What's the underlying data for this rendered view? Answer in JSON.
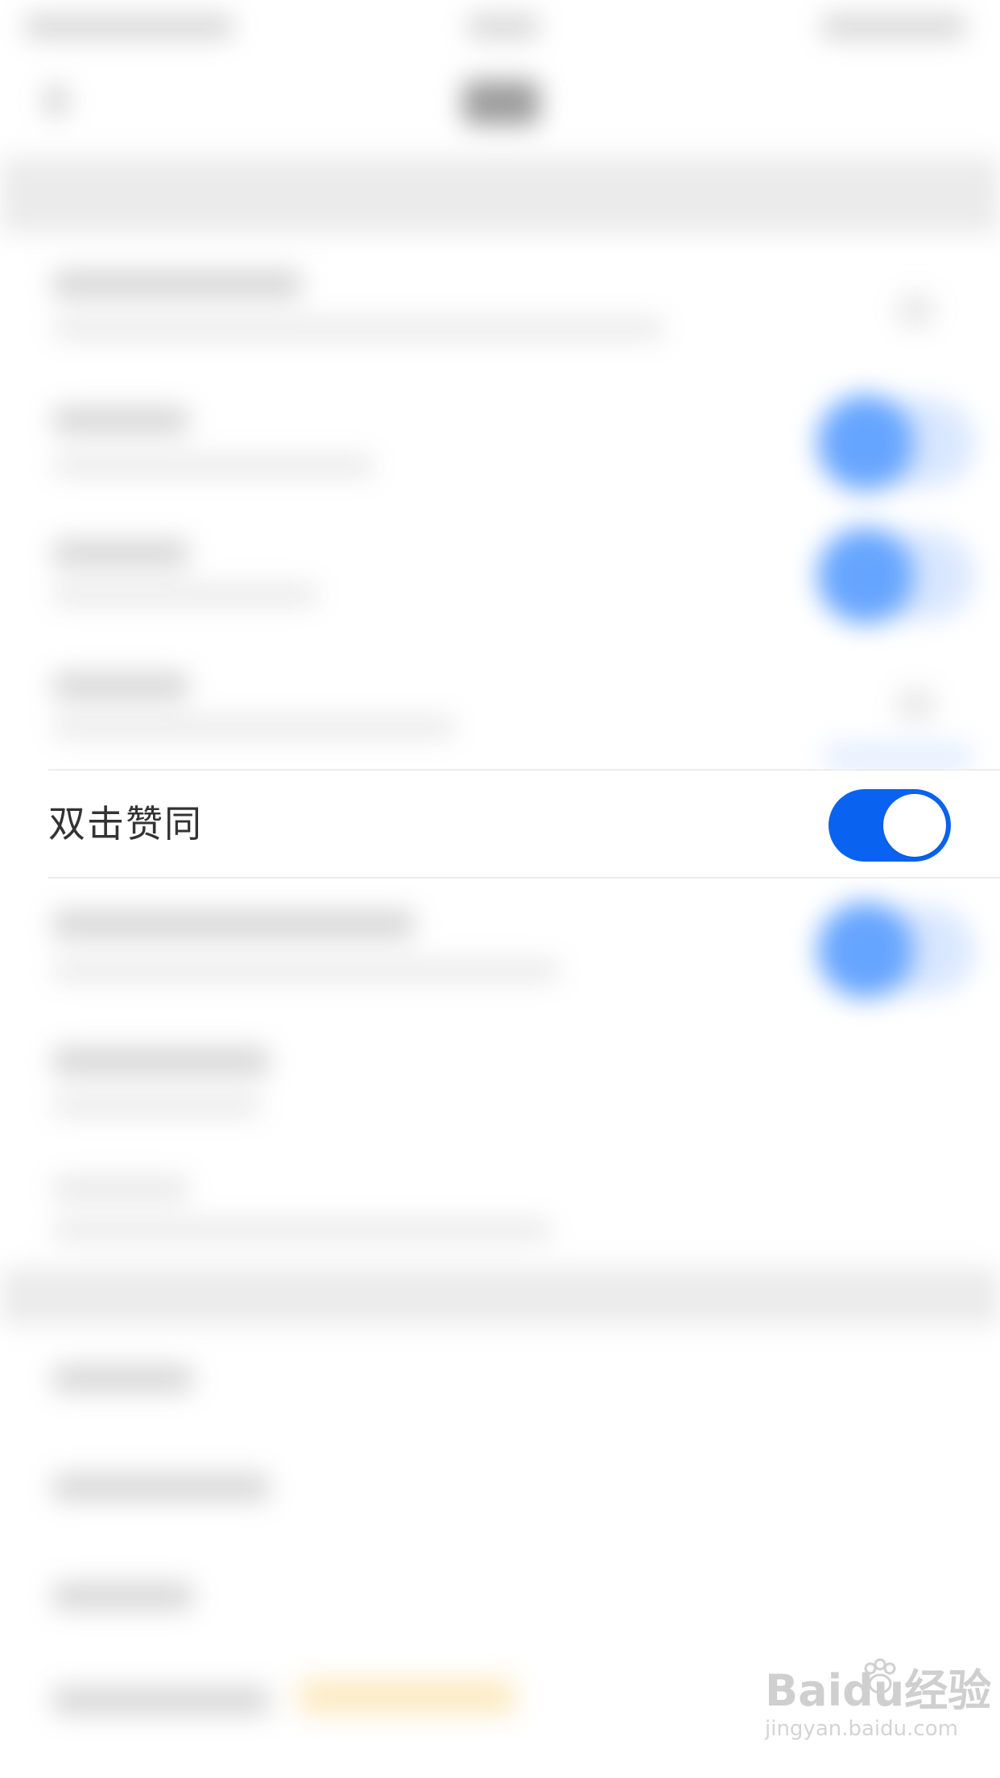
{
  "setting_row": {
    "label": "双击赞同",
    "toggle_on": true,
    "toggle_color": "#0a63f0"
  },
  "watermark": {
    "logo_text": "Baidu经验",
    "url": "jingyan.baidu.com"
  }
}
